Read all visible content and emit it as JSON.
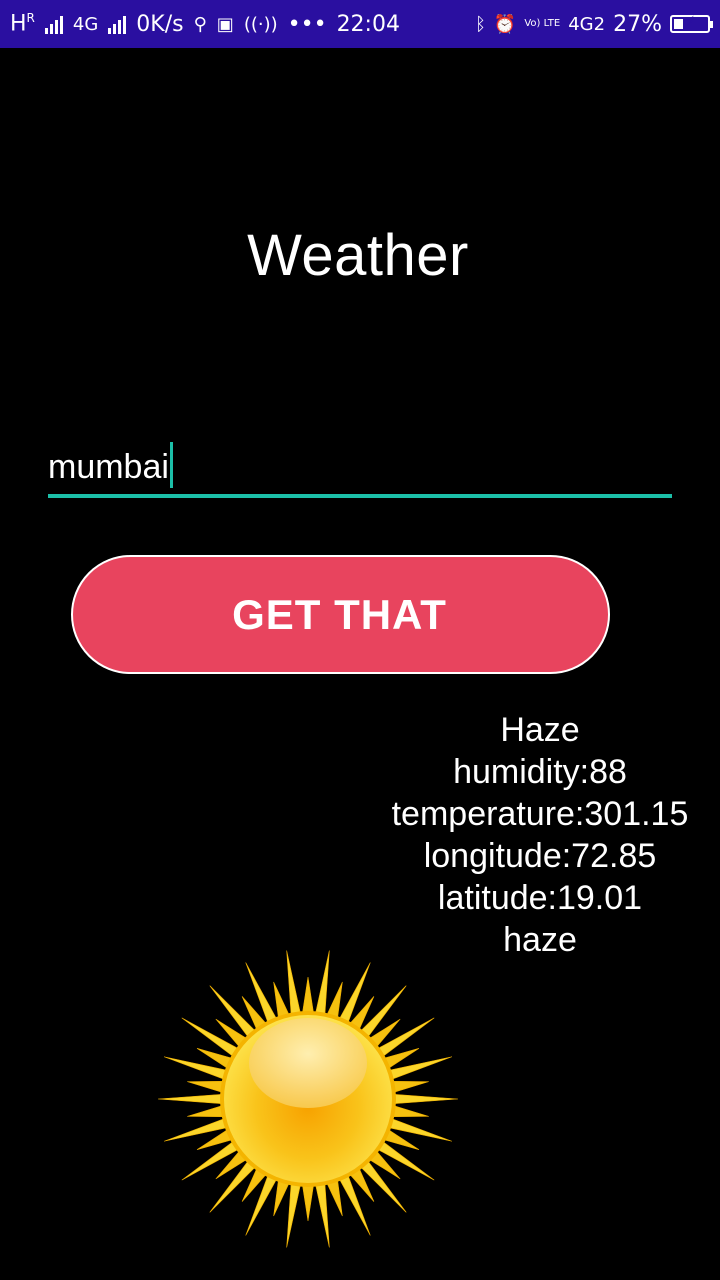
{
  "status_bar": {
    "network_hr": "H",
    "network_r": "R",
    "network_type": "4G",
    "speed": "0K/s",
    "time": "22:04",
    "volte": "Vo) LTE",
    "network_type_2": "4G2",
    "battery_percent": "27%",
    "battery_level": 0.27,
    "icons": [
      "signal-icon",
      "usb-icon",
      "notification-icon",
      "hotspot-icon",
      "more-dots-icon",
      "bluetooth-icon",
      "alarm-icon",
      "battery-icon"
    ]
  },
  "app": {
    "title": "Weather"
  },
  "city_input": {
    "value": "mumbai"
  },
  "action": {
    "button_label": "GET THAT"
  },
  "results": {
    "description": "Haze",
    "humidity": "humidity:88",
    "temperature": "temperature:301.15",
    "longitude": "longitude:72.85",
    "latitude": "latitude:19.01",
    "weather_main": "haze"
  },
  "image": {
    "icon": "sun-icon"
  },
  "colors": {
    "status_bar": "#2a0fa0",
    "background": "#000000",
    "accent": "#1cbfa8",
    "button": "#e8445e"
  }
}
